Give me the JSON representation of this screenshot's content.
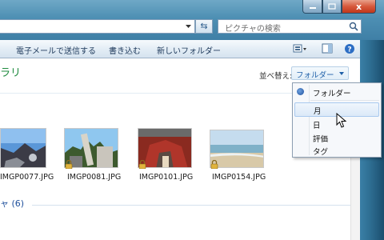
{
  "search": {
    "placeholder": "ピクチャの検索"
  },
  "window_buttons": {
    "close_label": "x"
  },
  "toolbar": {
    "email_label": "電子メールで送信する",
    "burn_label": "書き込む",
    "new_folder_label": "新しいフォルダー"
  },
  "header": {
    "title_fragment": "ラリ",
    "sort_label": "並べ替え:",
    "sort_value": "フォルダー"
  },
  "thumbnails": [
    {
      "name": "IMGP0077.JPG",
      "locked": false
    },
    {
      "name": "IMGP0081.JPG",
      "locked": true
    },
    {
      "name": "IMGP0101.JPG",
      "locked": true
    },
    {
      "name": "IMGP0154.JPG",
      "locked": true
    }
  ],
  "group": {
    "label": "ャ (6)"
  },
  "sort_menu": {
    "items": [
      {
        "label": "フォルダー",
        "selected": true
      },
      {
        "label": "月",
        "hover": true
      },
      {
        "label": "日"
      },
      {
        "label": "評価"
      },
      {
        "label": "タグ"
      }
    ]
  },
  "colors": {
    "aero_glass": "#4d8fb3",
    "title_green": "#1e8a3e",
    "link_blue": "#1e5fa8",
    "close_red": "#c0381b"
  }
}
